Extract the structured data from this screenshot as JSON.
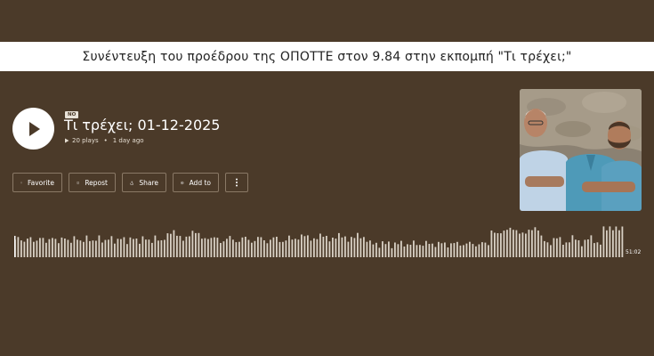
{
  "banner": {
    "text": "Συνέντευξη του προέδρου της ΟΠΟΤΤΕ στον 9.84 στην εκπομπή \"Τι τρέχει;\""
  },
  "track": {
    "badge": "NO",
    "title": "Τι τρέχει; 01-12-2025",
    "plays": "20 plays",
    "age": "1 day ago",
    "duration": "51:02",
    "progress": 0.0
  },
  "actions": {
    "favorite": "Favorite",
    "repost": "Repost",
    "share": "Share",
    "add_to": "Add to"
  },
  "icons": {
    "play": "play-icon",
    "heart": "heart-icon",
    "repost": "repost-icon",
    "share": "share-icon",
    "add": "add-circle-icon",
    "more": "more-vertical-icon"
  },
  "colors": {
    "background": "#4b3a29",
    "wave": "#d8d0c4",
    "banner_bg": "#ffffff"
  }
}
